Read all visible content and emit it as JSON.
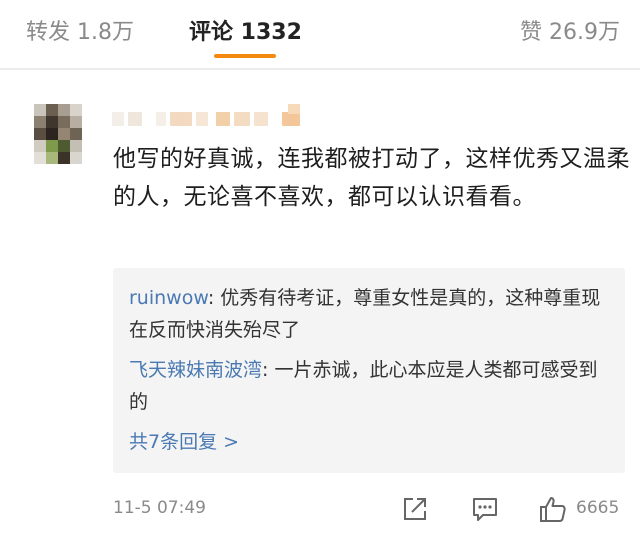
{
  "tabs": {
    "repost": "转发 1.8万",
    "comments": "评论 1332",
    "likes": "赞 26.9万"
  },
  "comment": {
    "text": "他写的好真诚，连我都被打动了，这样优秀又温柔的人，无论喜不喜欢，都可以认识看看。",
    "timestamp": "11-5 07:49",
    "like_count": "6665"
  },
  "replies": [
    {
      "user": "ruinwow",
      "text": ": 优秀有待考证，尊重女性是真的，这种尊重现在反而快消失殆尽了"
    },
    {
      "user": "飞天辣妹南波湾",
      "text": ": 一片赤诚，此心本应是人类都可感受到的"
    }
  ],
  "more_replies": "共7条回复 >",
  "colors": {
    "accent": "#f58a11",
    "link": "#4a79b3",
    "muted": "#8a8a8a",
    "reply_bg": "#f4f4f4"
  },
  "icons": [
    "avatar-image",
    "share-icon",
    "comment-icon",
    "like-icon"
  ]
}
